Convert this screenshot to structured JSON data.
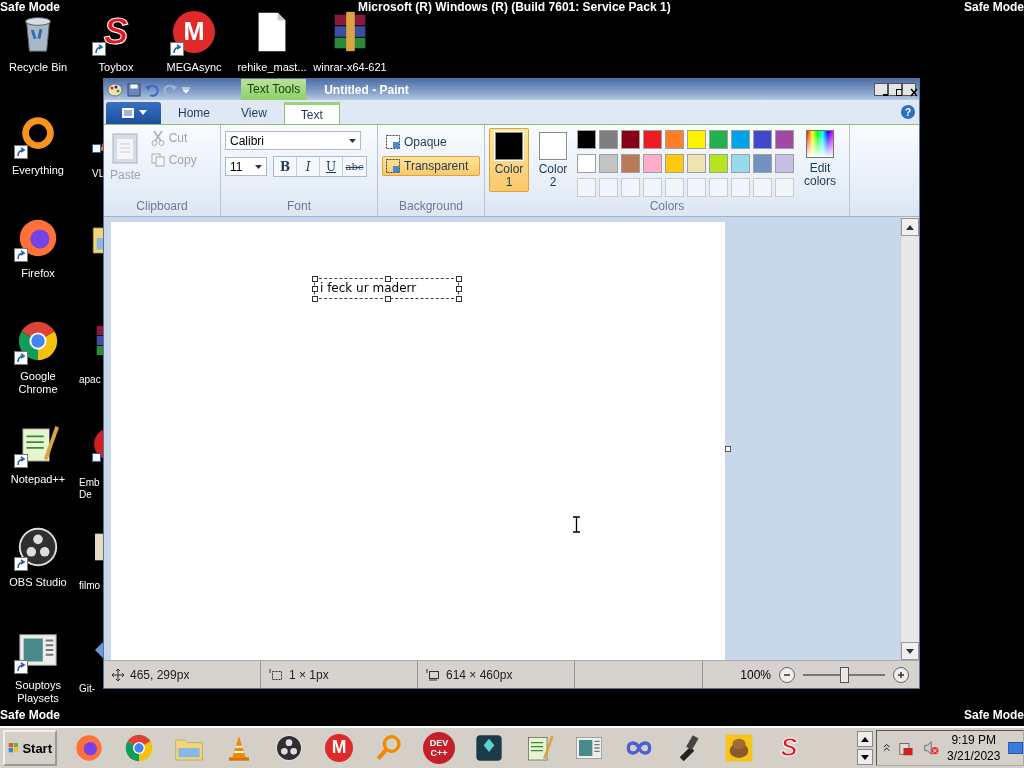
{
  "banners": {
    "top_left": "Safe Mode",
    "top_center": "Microsoft (R) Windows (R) (Build 7601: Service Pack 1)",
    "top_right": "Safe Mode",
    "bottom_left": "Safe Mode",
    "bottom_right": "Safe Mode"
  },
  "desktop_columns": [
    [
      {
        "label": "Recycle Bin",
        "kind": "recycle",
        "shortcut": false
      },
      {
        "label": "Everything",
        "kind": "ring",
        "shortcut": true
      },
      {
        "label": "Firefox",
        "kind": "firefox",
        "shortcut": true
      },
      {
        "label": "Google Chrome",
        "kind": "chrome",
        "shortcut": true
      },
      {
        "label": "Notepad++",
        "kind": "notepad",
        "shortcut": true
      },
      {
        "label": "OBS Studio",
        "kind": "obs",
        "shortcut": true
      },
      {
        "label": "Souptoys Playsets",
        "kind": "picture",
        "shortcut": true
      }
    ],
    [
      {
        "label": "Toybox",
        "kind": "toybox",
        "glyph": "S",
        "shortcut": true
      },
      {
        "label": "VL",
        "kind": "cone",
        "shortcut": true
      },
      {
        "kind": "folder",
        "shortcut": false
      },
      {
        "label": "apac",
        "kind": "books",
        "shortcut": false
      },
      {
        "label": "Emb\nDe",
        "kind": "red",
        "shortcut": true
      },
      {
        "label": "filmo",
        "kind": "beige",
        "shortcut": false
      },
      {
        "label": "Git-",
        "kind": "diamond",
        "shortcut": false
      }
    ],
    [
      {
        "label": "MEGAsync",
        "kind": "mega",
        "glyph": "M",
        "shortcut": true
      }
    ],
    [
      {
        "label": "rehike_mast...",
        "kind": "file",
        "shortcut": false
      }
    ],
    [
      {
        "label": "winrar-x64-621",
        "kind": "books",
        "shortcut": false
      }
    ]
  ],
  "window": {
    "title": "Untitled - Paint",
    "context_tab": "Text Tools",
    "help_glyph": "?",
    "tabs": [
      {
        "label": "Home",
        "selected": false
      },
      {
        "label": "View",
        "selected": false
      },
      {
        "label": "Text",
        "selected": true
      }
    ],
    "clipboard": {
      "label": "Clipboard",
      "paste": {
        "label": "Paste",
        "disabled": true
      },
      "cut": {
        "label": "Cut",
        "disabled": true
      },
      "copy": {
        "label": "Copy",
        "disabled": true
      }
    },
    "font": {
      "label": "Font",
      "family": "Calibri",
      "size": "11",
      "styles": [
        {
          "kind": "bold",
          "glyph": "B"
        },
        {
          "kind": "italic",
          "glyph": "I"
        },
        {
          "kind": "underline",
          "glyph": "U"
        },
        {
          "kind": "strike",
          "glyph": "abc"
        }
      ]
    },
    "background": {
      "label": "Background",
      "options": [
        {
          "label": "Opaque",
          "selected": false
        },
        {
          "label": "Transparent",
          "selected": true
        }
      ]
    },
    "colors": {
      "label": "Colors",
      "slots": [
        {
          "label": "Color 1",
          "color": "#000000",
          "selected": true
        },
        {
          "label": "Color 2",
          "color": "#ffffff",
          "selected": false
        }
      ],
      "palette": [
        {
          "color": "#000000"
        },
        {
          "color": "#7f7f7f"
        },
        {
          "color": "#880015"
        },
        {
          "color": "#ed1c24"
        },
        {
          "color": "#ff7f27"
        },
        {
          "color": "#fff200"
        },
        {
          "color": "#22b14c"
        },
        {
          "color": "#00a2e8"
        },
        {
          "color": "#3f48cc"
        },
        {
          "color": "#a349a4"
        },
        {
          "color": "#ffffff"
        },
        {
          "color": "#c3c3c3"
        },
        {
          "color": "#b97a57"
        },
        {
          "color": "#ffaec9"
        },
        {
          "color": "#ffc90e"
        },
        {
          "color": "#efe4b0"
        },
        {
          "color": "#b5e61d"
        },
        {
          "color": "#99d9ea"
        },
        {
          "color": "#7092be"
        },
        {
          "color": "#c8bfe7"
        },
        {
          "kind": "empty"
        },
        {
          "kind": "empty"
        },
        {
          "kind": "empty"
        },
        {
          "kind": "empty"
        },
        {
          "kind": "empty"
        },
        {
          "kind": "empty"
        },
        {
          "kind": "empty"
        },
        {
          "kind": "empty"
        },
        {
          "kind": "empty"
        },
        {
          "kind": "empty"
        }
      ],
      "edit_colors": "Edit colors"
    },
    "canvas_text": "i feck ur maderr",
    "status_bar": {
      "cursor": "465, 299px",
      "selection": "1 × 1px",
      "image_size": "614 × 460px",
      "zoom": "100%",
      "zoom_slider": {
        "level": 0.5
      }
    }
  },
  "taskbar": {
    "start": "Start",
    "items": [
      {
        "kind": "firefox"
      },
      {
        "kind": "chrome"
      },
      {
        "kind": "folder"
      },
      {
        "kind": "cone"
      },
      {
        "kind": "obs"
      },
      {
        "kind": "mega",
        "glyph": "M"
      },
      {
        "kind": "magnifier"
      },
      {
        "kind": "devcpp",
        "glyph": "DEV C++"
      },
      {
        "kind": "tile"
      },
      {
        "kind": "notepad"
      },
      {
        "kind": "picture"
      },
      {
        "kind": "infinity"
      },
      {
        "kind": "tool"
      },
      {
        "kind": "animal"
      },
      {
        "kind": "toybox",
        "glyph": "S"
      }
    ],
    "time": "9:19 PM",
    "date": "3/21/2023"
  }
}
